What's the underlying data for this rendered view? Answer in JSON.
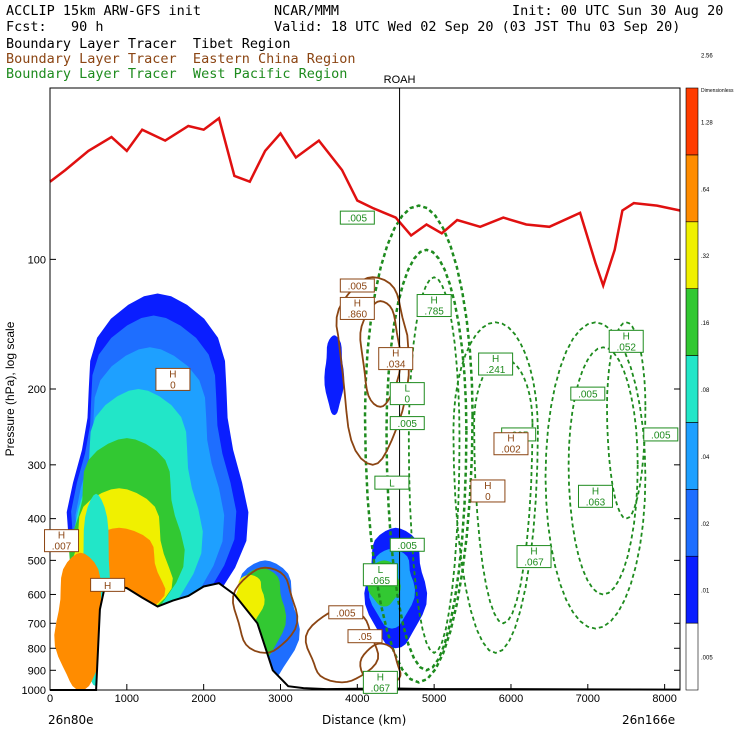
{
  "header": {
    "model": "ACCLIP 15km ARW-GFS init",
    "org": "NCAR/MMM",
    "init": "Init: 00 UTC Sun 30 Aug 20",
    "fcst": "Fcst:   90 h",
    "valid": "Valid: 18 UTC Wed 02 Sep 20 (03 JST Thu 03 Sep 20)",
    "lines": [
      {
        "text": "Boundary Layer Tracer  Tibet Region",
        "color": "#000000"
      },
      {
        "text": "Boundary Layer Tracer  Eastern China Region",
        "color": "#8b4513"
      },
      {
        "text": "Boundary Layer Tracer  West Pacific Region",
        "color": "#1e8b1e"
      }
    ]
  },
  "chart_data": {
    "type": "heatmap",
    "xlabel": "Distance (km)",
    "ylabel": "Pressure (hPa), log scale",
    "x_ticks": [
      0,
      1000,
      2000,
      3000,
      4000,
      5000,
      6000,
      7000,
      8000
    ],
    "x_left_label": "26n80e",
    "x_right_label": "26n166e",
    "y_ticks": [
      100,
      200,
      300,
      400,
      500,
      600,
      700,
      800,
      900,
      1000
    ],
    "xlim": [
      0,
      8200
    ],
    "ylim": [
      1000,
      40
    ],
    "y_scale": "log",
    "vertical_line": {
      "x": 4550,
      "label": "ROAH"
    },
    "colorbar": {
      "title": "Dimensionless",
      "levels": [
        ".005",
        ".01",
        ".02",
        ".04",
        ".08",
        ".16",
        ".32",
        ".64",
        "1.28",
        "2.56"
      ],
      "colors": [
        "#ffffff",
        "#0a1eff",
        "#1e6eff",
        "#1ea0ff",
        "#22e6c8",
        "#32c832",
        "#f0f000",
        "#ff8c00",
        "#ff3c00"
      ]
    },
    "labels_green": [
      {
        "x": 4000,
        "p": 80,
        "kind": "",
        "value": ".005"
      },
      {
        "x": 5000,
        "p": 128,
        "kind": "H",
        "value": ".785"
      },
      {
        "x": 5800,
        "p": 175,
        "kind": "H",
        "value": ".241"
      },
      {
        "x": 7500,
        "p": 155,
        "kind": "H",
        "value": ".052"
      },
      {
        "x": 7000,
        "p": 205,
        "kind": "",
        "value": ".005"
      },
      {
        "x": 4650,
        "p": 205,
        "kind": "L",
        "value": "0"
      },
      {
        "x": 4650,
        "p": 240,
        "kind": "",
        "value": ".005"
      },
      {
        "x": 6100,
        "p": 255,
        "kind": "",
        "value": ".005"
      },
      {
        "x": 7950,
        "p": 255,
        "kind": "",
        "value": ".005"
      },
      {
        "x": 4450,
        "p": 330,
        "kind": "L",
        "value": ""
      },
      {
        "x": 7100,
        "p": 355,
        "kind": "H",
        "value": ".063"
      },
      {
        "x": 4650,
        "p": 460,
        "kind": "",
        "value": ".005"
      },
      {
        "x": 6300,
        "p": 490,
        "kind": "H",
        "value": ".067"
      },
      {
        "x": 4300,
        "p": 540,
        "kind": "L",
        "value": ".065"
      },
      {
        "x": 4300,
        "p": 960,
        "kind": "H",
        "value": ".067"
      }
    ],
    "labels_brown": [
      {
        "x": 4000,
        "p": 115,
        "kind": "",
        "value": ".005"
      },
      {
        "x": 4000,
        "p": 130,
        "kind": "H",
        "value": ".860"
      },
      {
        "x": 4500,
        "p": 170,
        "kind": "H",
        "value": ".034"
      },
      {
        "x": 6000,
        "p": 268,
        "kind": "H",
        "value": ".002"
      },
      {
        "x": 5700,
        "p": 345,
        "kind": "H",
        "value": "0"
      },
      {
        "x": 3850,
        "p": 660,
        "kind": "",
        "value": ".005"
      },
      {
        "x": 4100,
        "p": 750,
        "kind": "",
        "value": ".05"
      }
    ],
    "labels_black": [
      {
        "x": 1600,
        "p": 190,
        "kind": "H",
        "value": "0"
      },
      {
        "x": 150,
        "p": 450,
        "kind": "H",
        "value": ".007"
      },
      {
        "x": 750,
        "p": 570,
        "kind": "H",
        "value": ""
      }
    ],
    "tropopause_hpa": [
      [
        0,
        66
      ],
      [
        200,
        62
      ],
      [
        500,
        56
      ],
      [
        800,
        52
      ],
      [
        1000,
        56
      ],
      [
        1200,
        50
      ],
      [
        1500,
        53
      ],
      [
        1800,
        49
      ],
      [
        2000,
        50
      ],
      [
        2200,
        47
      ],
      [
        2400,
        64
      ],
      [
        2600,
        66
      ],
      [
        2800,
        56
      ],
      [
        3000,
        51
      ],
      [
        3200,
        58
      ],
      [
        3500,
        53
      ],
      [
        3800,
        62
      ],
      [
        4000,
        73
      ],
      [
        4200,
        76
      ],
      [
        4500,
        80
      ],
      [
        4700,
        88
      ],
      [
        4900,
        83
      ],
      [
        5100,
        87
      ],
      [
        5300,
        81
      ],
      [
        5600,
        84
      ],
      [
        5900,
        80
      ],
      [
        6200,
        83
      ],
      [
        6500,
        84
      ],
      [
        6900,
        78
      ],
      [
        7100,
        102
      ],
      [
        7200,
        115
      ],
      [
        7350,
        95
      ],
      [
        7450,
        77
      ],
      [
        7600,
        74
      ],
      [
        7900,
        75
      ],
      [
        8200,
        77
      ]
    ],
    "terrain_hpa": [
      [
        0,
        1000
      ],
      [
        600,
        1000
      ],
      [
        650,
        650
      ],
      [
        700,
        590
      ],
      [
        800,
        570
      ],
      [
        1000,
        580
      ],
      [
        1200,
        610
      ],
      [
        1400,
        640
      ],
      [
        1600,
        620
      ],
      [
        1800,
        605
      ],
      [
        2000,
        575
      ],
      [
        2200,
        565
      ],
      [
        2400,
        600
      ],
      [
        2700,
        700
      ],
      [
        2900,
        900
      ],
      [
        3100,
        980
      ],
      [
        3300,
        990
      ],
      [
        3600,
        995
      ],
      [
        4000,
        993
      ],
      [
        4500,
        992
      ],
      [
        5000,
        995
      ],
      [
        6000,
        995
      ],
      [
        7000,
        997
      ],
      [
        8200,
        998
      ]
    ]
  }
}
